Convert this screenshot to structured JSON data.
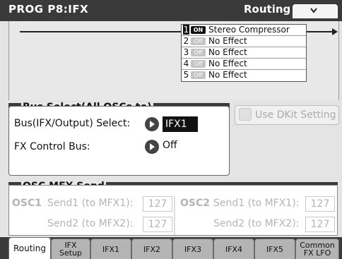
{
  "header": {
    "title": "PROG P8:IFX",
    "page": "Routing",
    "menu_icon": "chevron-down-icon"
  },
  "ifx_chain": [
    {
      "num": "1",
      "switch": "ON",
      "name": "Stereo Compressor",
      "selected": true
    },
    {
      "num": "2",
      "switch": "Off",
      "name": "No Effect",
      "selected": false
    },
    {
      "num": "3",
      "switch": "Off",
      "name": "No Effect",
      "selected": false
    },
    {
      "num": "4",
      "switch": "Off",
      "name": "No Effect",
      "selected": false
    },
    {
      "num": "5",
      "switch": "Off",
      "name": "No Effect",
      "selected": false
    }
  ],
  "bus_select": {
    "heading": "Bus Select(All OSCs to)",
    "bus_label": "Bus(IFX/Output) Select:",
    "bus_value": "IFX1",
    "fx_ctrl_label": "FX Control Bus:",
    "fx_ctrl_value": "Off"
  },
  "dkit": {
    "label": "Use DKit Setting",
    "enabled": false
  },
  "osc_mfx_send": {
    "heading": "OSC MFX Send",
    "osc1": {
      "label": "OSC1",
      "send1_label": "Send1 (to MFX1):",
      "send1_value": "127",
      "send2_label": "Send2 (to MFX2):",
      "send2_value": "127"
    },
    "osc2": {
      "label": "OSC2",
      "send1_label": "Send1 (to MFX1):",
      "send1_value": "127",
      "send2_label": "Send2 (to MFX2):",
      "send2_value": "127"
    }
  },
  "tabs": [
    {
      "label": "Routing",
      "active": true
    },
    {
      "label": "IFX Setup",
      "line1": "IFX",
      "line2": "Setup"
    },
    {
      "label": "IFX1"
    },
    {
      "label": "IFX2"
    },
    {
      "label": "IFX3"
    },
    {
      "label": "IFX4"
    },
    {
      "label": "IFX5"
    },
    {
      "label": "Common FX LFO",
      "line1": "Common",
      "line2": "FX LFO"
    }
  ],
  "colors": {
    "header_bg": "#3a3a3a",
    "panel_bg": "#e4e4e4",
    "dim_text": "#b4b4b4"
  }
}
